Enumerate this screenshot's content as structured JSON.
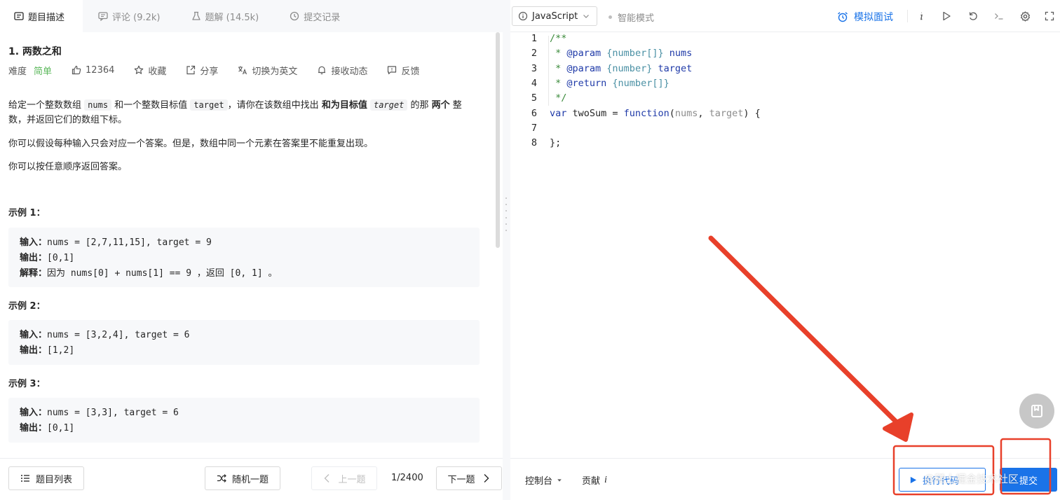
{
  "tabs": [
    {
      "label": "题目描述",
      "icon": "description-icon",
      "active": true
    },
    {
      "label": "评论 (9.2k)",
      "icon": "comment-icon",
      "active": false
    },
    {
      "label": "题解 (14.5k)",
      "icon": "flask-icon",
      "active": false
    },
    {
      "label": "提交记录",
      "icon": "history-icon",
      "active": false
    }
  ],
  "problem": {
    "title": "1. 两数之和",
    "difficulty_label": "难度",
    "difficulty": "简单",
    "likes": "12364",
    "favorite": "收藏",
    "share": "分享",
    "switch_lang": "切换为英文",
    "subscribe": "接收动态",
    "feedback": "反馈"
  },
  "description": {
    "p1_a": "给定一个整数数组 ",
    "p1_code1": "nums",
    "p1_b": " 和一个整数目标值 ",
    "p1_code2": "target",
    "p1_c": "，请你在该数组中找出 ",
    "p1_bold1": "和为目标值",
    "p1_code3": "target",
    "p1_d": " 的那 ",
    "p1_bold2": "两个",
    "p1_e": " 整数，并返回它们的数组下标。",
    "p2": "你可以假设每种输入只会对应一个答案。但是，数组中同一个元素在答案里不能重复出现。",
    "p3": "你可以按任意顺序返回答案。"
  },
  "examples": [
    {
      "title": "示例 1：",
      "input_label": "输入：",
      "input": "nums = [2,7,11,15], target = 9",
      "output_label": "输出：",
      "output": "[0,1]",
      "explain_label": "解释：",
      "explain": "因为 nums[0] + nums[1] == 9 ，返回 [0, 1] 。"
    },
    {
      "title": "示例 2：",
      "input_label": "输入：",
      "input": "nums = [3,2,4], target = 6",
      "output_label": "输出：",
      "output": "[1,2]"
    },
    {
      "title": "示例 3：",
      "input_label": "输入：",
      "input": "nums = [3,3], target = 6",
      "output_label": "输出：",
      "output": "[0,1]"
    }
  ],
  "footer_left": {
    "problem_list": "题目列表",
    "random": "随机一题",
    "prev": "上一题",
    "pager": "1/2400",
    "next": "下一题"
  },
  "editor_toolbar": {
    "language": "JavaScript",
    "smart_mode": "智能模式",
    "mock_interview": "模拟面试"
  },
  "code_lines": [
    {
      "n": "1",
      "tokens": [
        {
          "t": "/**",
          "c": "c-com"
        }
      ]
    },
    {
      "n": "2",
      "tokens": [
        {
          "t": " * ",
          "c": "c-com"
        },
        {
          "t": "@param",
          "c": "c-kw"
        },
        {
          "t": " {number[]}",
          "c": "c-type"
        },
        {
          "t": " nums",
          "c": "c-kw"
        }
      ]
    },
    {
      "n": "3",
      "tokens": [
        {
          "t": " * ",
          "c": "c-com"
        },
        {
          "t": "@param",
          "c": "c-kw"
        },
        {
          "t": " {number}",
          "c": "c-type"
        },
        {
          "t": " target",
          "c": "c-kw"
        }
      ]
    },
    {
      "n": "4",
      "tokens": [
        {
          "t": " * ",
          "c": "c-com"
        },
        {
          "t": "@return",
          "c": "c-kw"
        },
        {
          "t": " {number[]}",
          "c": "c-type"
        }
      ]
    },
    {
      "n": "5",
      "tokens": [
        {
          "t": " */",
          "c": "c-com"
        }
      ]
    },
    {
      "n": "6",
      "tokens": [
        {
          "t": "var",
          "c": "c-kw"
        },
        {
          "t": " twoSum = ",
          "c": "c-plain"
        },
        {
          "t": "function",
          "c": "c-fn"
        },
        {
          "t": "(",
          "c": "c-plain"
        },
        {
          "t": "nums",
          "c": "c-param"
        },
        {
          "t": ", ",
          "c": "c-plain"
        },
        {
          "t": "target",
          "c": "c-param"
        },
        {
          "t": ") {",
          "c": "c-plain"
        }
      ]
    },
    {
      "n": "7",
      "tokens": []
    },
    {
      "n": "8",
      "tokens": [
        {
          "t": "};",
          "c": "c-plain"
        }
      ]
    }
  ],
  "footer_right": {
    "console": "控制台",
    "contribute": "贡献",
    "run": "执行代码",
    "submit": "提交"
  },
  "watermark": "@稀土掘金技术社区",
  "colors": {
    "accent": "#1a73e8",
    "easy": "#5cb85c",
    "annotation": "#e8402a"
  }
}
